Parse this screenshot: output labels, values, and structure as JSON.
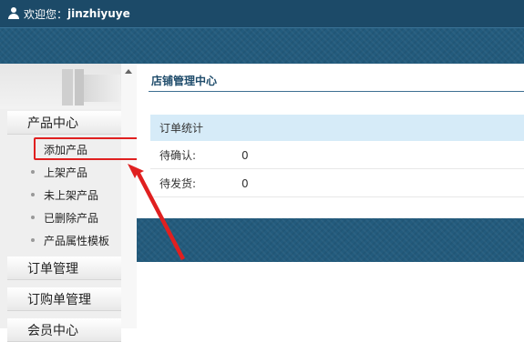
{
  "topbar": {
    "welcome": "欢迎您：",
    "username": "jinzhiyuye"
  },
  "sidebar": {
    "sections": [
      {
        "label": "产品中心"
      },
      {
        "label": "订单管理"
      },
      {
        "label": "订购单管理"
      },
      {
        "label": "会员中心"
      }
    ],
    "items": [
      {
        "label": "添加产品"
      },
      {
        "label": "上架产品"
      },
      {
        "label": "未上架产品"
      },
      {
        "label": "已删除产品"
      },
      {
        "label": "产品属性模板"
      }
    ]
  },
  "main": {
    "title": "店铺管理中心",
    "stats": {
      "header": "订单统计",
      "rows": [
        {
          "label": "待确认:",
          "value": "0"
        },
        {
          "label": "待发货:",
          "value": "0"
        }
      ]
    }
  },
  "colors": {
    "header_bg": "#1c4a68",
    "accent": "#235b7d",
    "annotation_red": "#e02020",
    "stats_header_bg": "#d6ebf8"
  }
}
